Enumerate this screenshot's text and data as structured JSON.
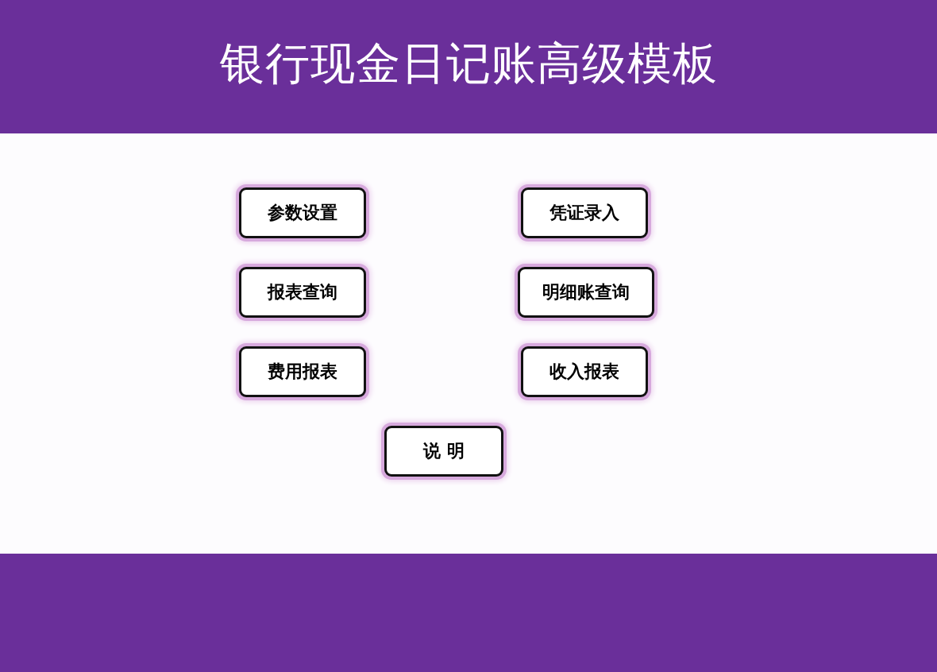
{
  "header": {
    "title": "银行现金日记账高级模板"
  },
  "buttons": [
    {
      "label": "参数设置"
    },
    {
      "label": "凭证录入"
    },
    {
      "label": "报表查询"
    },
    {
      "label": "明细账查询"
    },
    {
      "label": "费用报表"
    },
    {
      "label": "收入报表"
    },
    {
      "label": "说 明"
    }
  ]
}
